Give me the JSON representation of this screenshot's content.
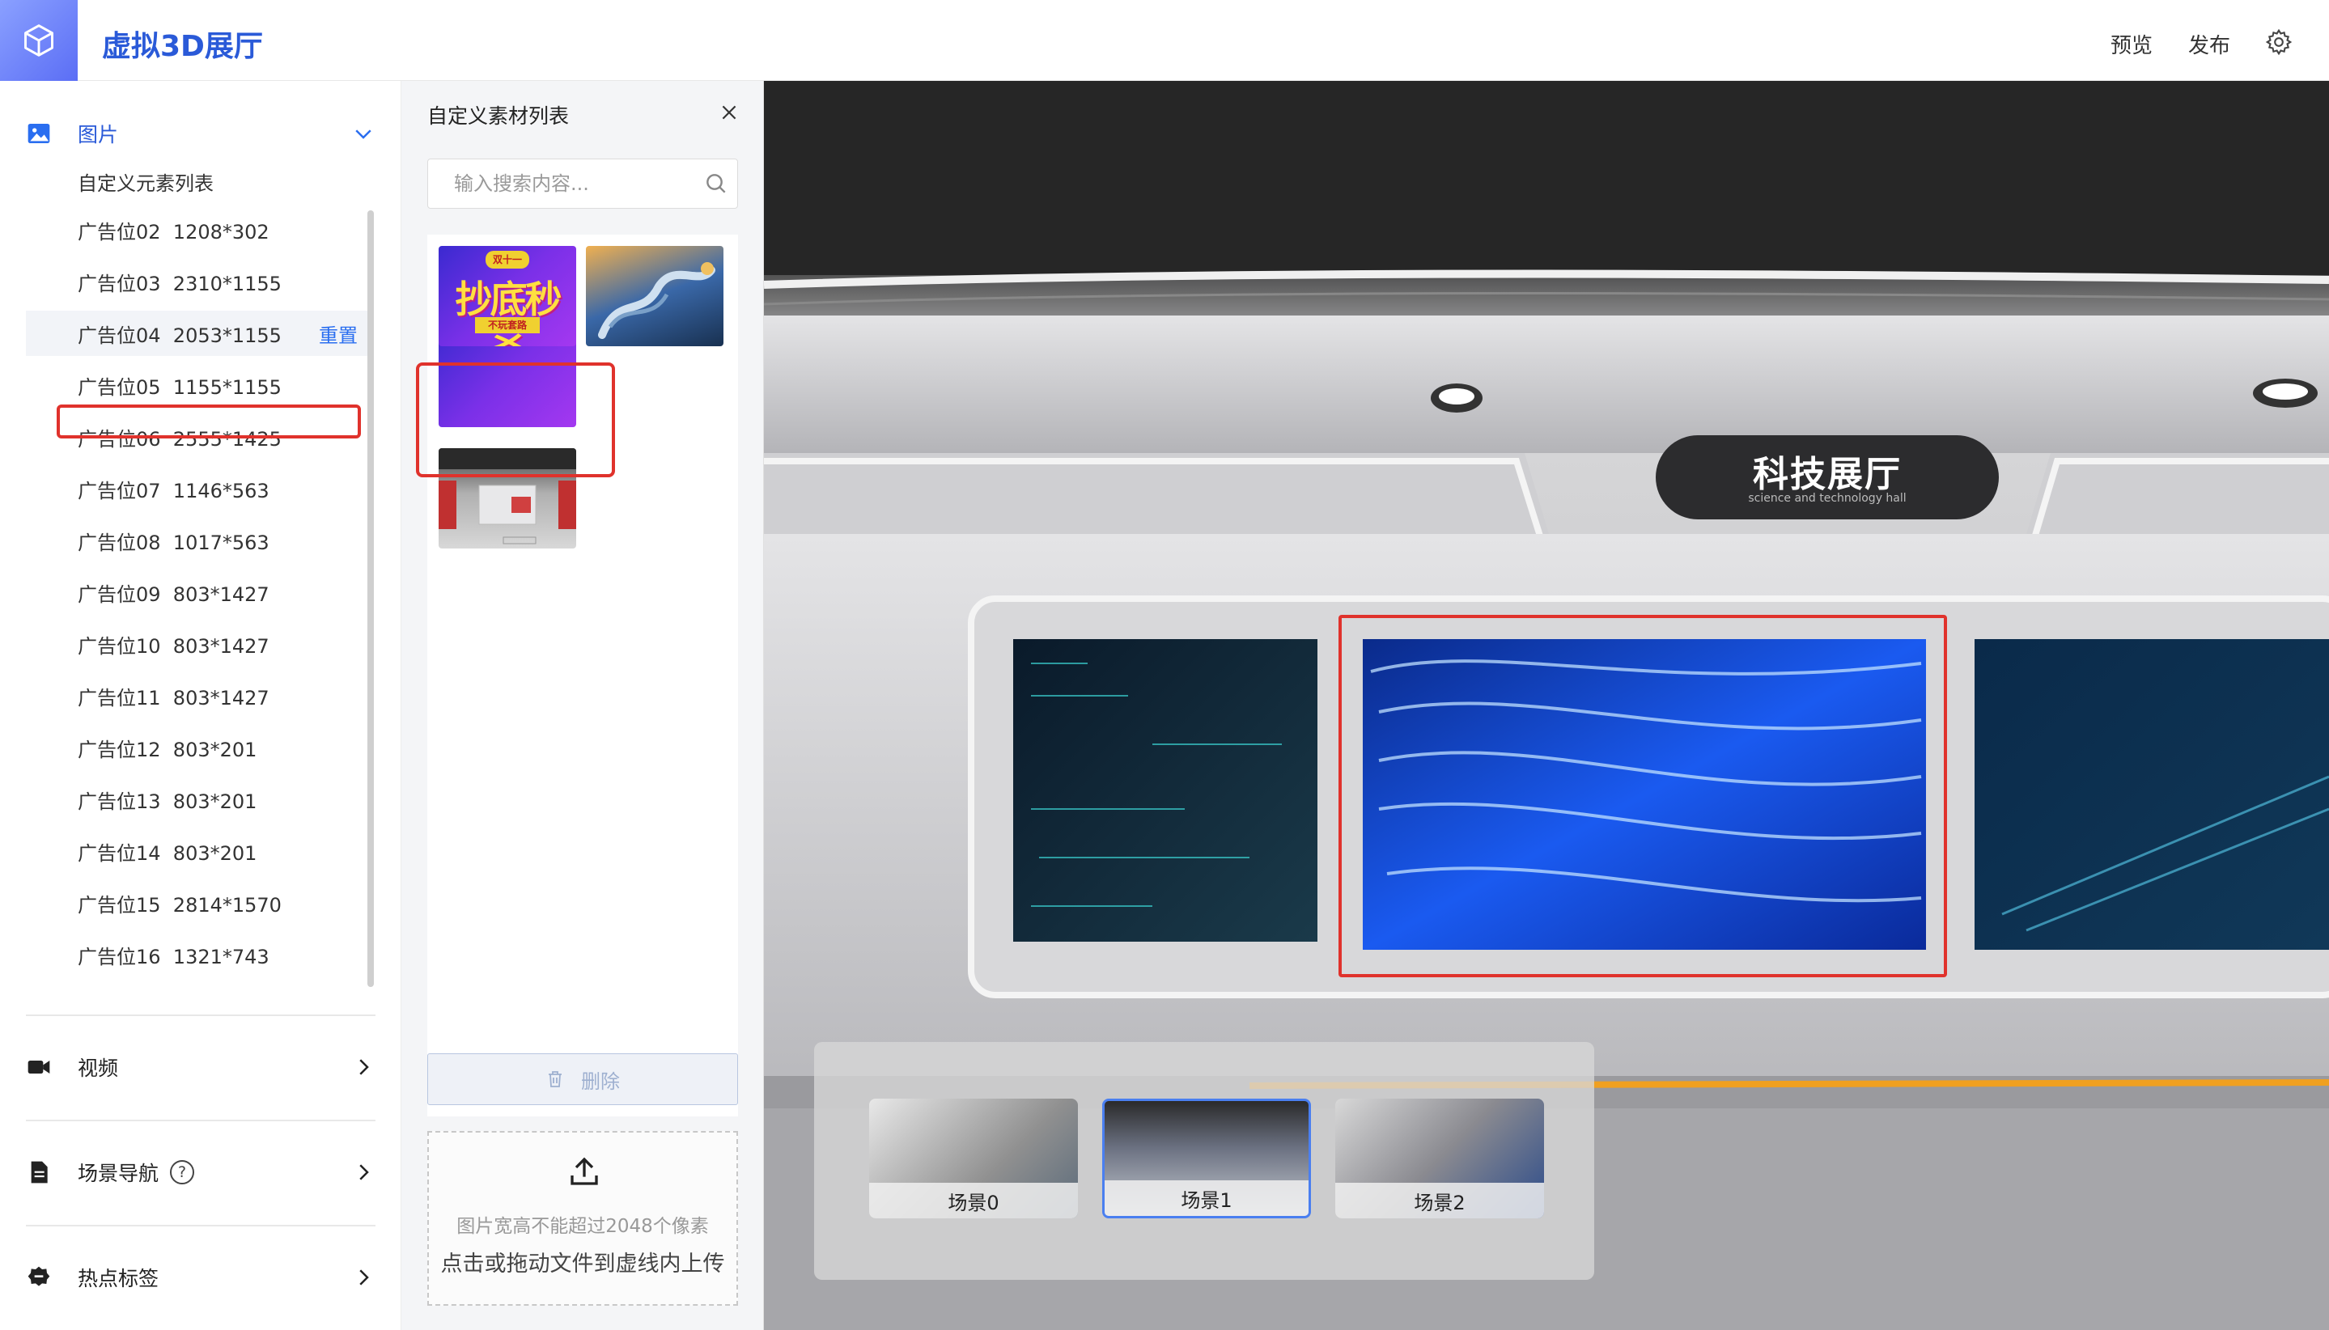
{
  "header": {
    "title": "虚拟3D展厅",
    "preview": "预览",
    "publish": "发布",
    "accent": "#2a5ad8"
  },
  "sidebar": {
    "images_section": "图片",
    "custom_list_title": "自定义元素列表",
    "items": [
      {
        "label": "广告位02  1208*302"
      },
      {
        "label": "广告位03  2310*1155"
      },
      {
        "label": "广告位04  2053*1155",
        "selected": true,
        "action": "重置"
      },
      {
        "label": "广告位05  1155*1155"
      },
      {
        "label": "广告位06  2555*1425"
      },
      {
        "label": "广告位07  1146*563"
      },
      {
        "label": "广告位08  1017*563"
      },
      {
        "label": "广告位09  803*1427"
      },
      {
        "label": "广告位10  803*1427"
      },
      {
        "label": "广告位11  803*1427"
      },
      {
        "label": "广告位12  803*201"
      },
      {
        "label": "广告位13  803*201"
      },
      {
        "label": "广告位14  803*201"
      },
      {
        "label": "广告位15  2814*1570"
      },
      {
        "label": "广告位16  1321*743"
      }
    ],
    "video_section": "视频",
    "scene_nav_section": "场景导航",
    "hotspot_section": "热点标签"
  },
  "panel": {
    "title": "自定义素材列表",
    "search_placeholder": "输入搜索内容...",
    "thumb1_text": "抄底秒杀",
    "thumb1_sub": "不玩套路",
    "thumb1_badge": "双十一",
    "delete": "删除",
    "upload_hint": "图片宽高不能超过2048个像素",
    "upload_text": "点击或拖动文件到虚线内上传"
  },
  "viewport": {
    "sign_title": "科技展厅",
    "sign_subtitle": "science and technology hall",
    "scenes": [
      {
        "label": "场景0"
      },
      {
        "label": "场景1",
        "active": true
      },
      {
        "label": "场景2"
      }
    ]
  }
}
